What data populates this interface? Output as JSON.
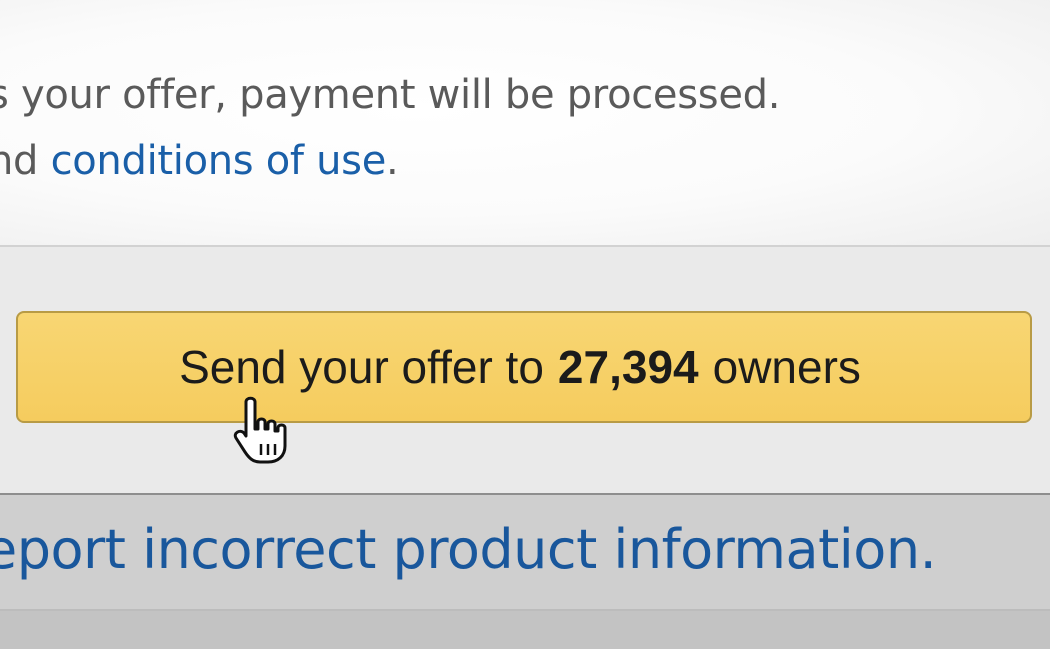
{
  "terms": {
    "line1": "s your offer, payment will be processed.",
    "line2_prefix": "nd ",
    "line2_link": "conditions of use",
    "line2_suffix": "."
  },
  "offer_button": {
    "prefix": "Send your offer to",
    "count": "27,394",
    "suffix": "owners"
  },
  "report_link": "eport incorrect product information.",
  "cursor": {
    "icon": "hand-pointer-icon"
  },
  "colors": {
    "button_fill": "#f6d06a",
    "link": "#1a5fa8"
  }
}
